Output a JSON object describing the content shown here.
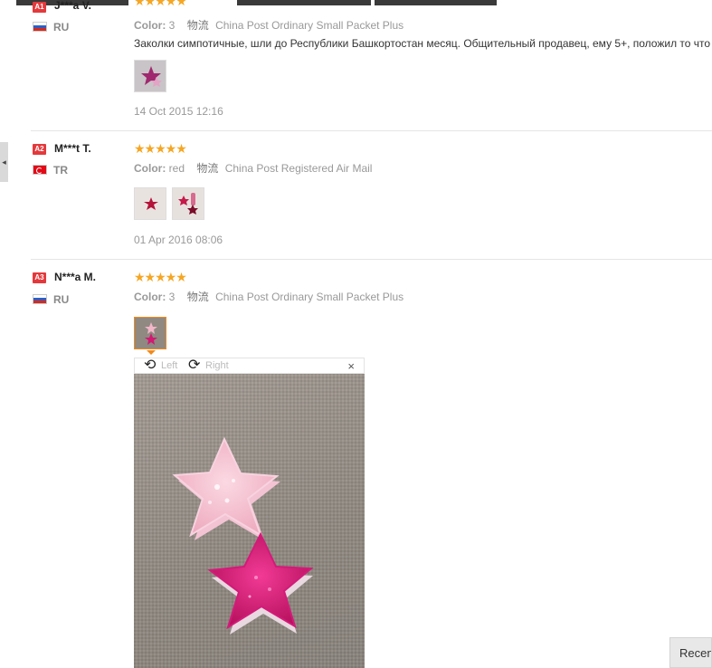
{
  "nav": {
    "left_tab_arrow": "◂",
    "recent_tab_label": "Recen"
  },
  "reviews": [
    {
      "rank": "A1",
      "name": "J***a V.",
      "country": "RU",
      "stars": "★★★★★",
      "color_label": "Color:",
      "color_value": "3",
      "shipping_label": "物流",
      "shipping_value": "China Post Ordinary Small Packet Plus",
      "feedback": "Заколки симпотичные, шли до Республики Башкортостан месяц. Общительный продавец, ему 5+, положил то что",
      "date": "14 Oct 2015 12:16"
    },
    {
      "rank": "A2",
      "name": "M***t T.",
      "country": "TR",
      "stars": "★★★★★",
      "color_label": "Color:",
      "color_value": "red",
      "shipping_label": "物流",
      "shipping_value": "China Post Registered Air Mail",
      "date": "01 Apr 2016 08:06"
    },
    {
      "rank": "A3",
      "name": "N***a M.",
      "country": "RU",
      "stars": "★★★★★",
      "color_label": "Color:",
      "color_value": "3",
      "shipping_label": "物流",
      "shipping_value": "China Post Ordinary Small Packet Plus"
    }
  ],
  "viewer": {
    "rotate_left_icon": "⟲",
    "rotate_left_label": "Left",
    "rotate_right_icon": "⟳",
    "rotate_right_label": "Right",
    "close_icon": "×"
  },
  "colors": {
    "star": "#f5a623",
    "badge": "#e4393c",
    "active_thumb_border": "#f08a1b"
  }
}
